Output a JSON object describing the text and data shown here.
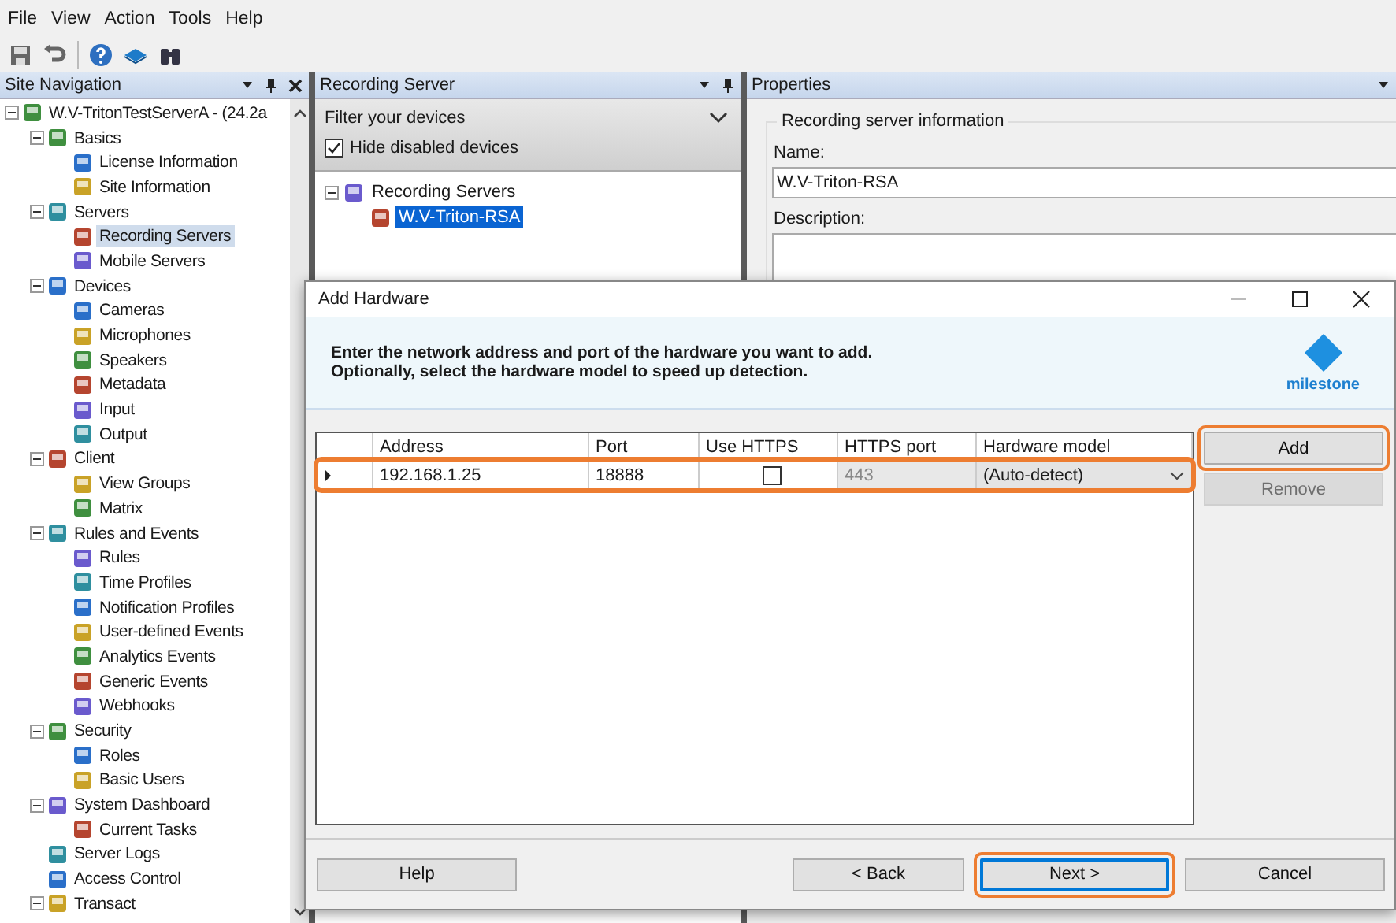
{
  "menu": [
    "File",
    "View",
    "Action",
    "Tools",
    "Help"
  ],
  "site_navigation": {
    "title": "Site Navigation",
    "tree": [
      {
        "label": "W.V-TritonTestServerA - (24.2a",
        "expanded": true,
        "selected": false,
        "children": [
          {
            "label": "Basics",
            "expanded": true,
            "selected": false,
            "children": [
              {
                "label": "License Information",
                "selected": false
              },
              {
                "label": "Site Information",
                "selected": false
              }
            ]
          },
          {
            "label": "Servers",
            "expanded": true,
            "selected": false,
            "children": [
              {
                "label": "Recording Servers",
                "selected": true
              },
              {
                "label": "Mobile Servers",
                "selected": false
              }
            ]
          },
          {
            "label": "Devices",
            "expanded": true,
            "selected": false,
            "children": [
              {
                "label": "Cameras",
                "selected": false
              },
              {
                "label": "Microphones",
                "selected": false
              },
              {
                "label": "Speakers",
                "selected": false
              },
              {
                "label": "Metadata",
                "selected": false
              },
              {
                "label": "Input",
                "selected": false
              },
              {
                "label": "Output",
                "selected": false
              }
            ]
          },
          {
            "label": "Client",
            "expanded": true,
            "selected": false,
            "children": [
              {
                "label": "View Groups",
                "selected": false
              },
              {
                "label": "Matrix",
                "selected": false
              }
            ]
          },
          {
            "label": "Rules and Events",
            "expanded": true,
            "selected": false,
            "children": [
              {
                "label": "Rules",
                "selected": false
              },
              {
                "label": "Time Profiles",
                "selected": false
              },
              {
                "label": "Notification Profiles",
                "selected": false
              },
              {
                "label": "User-defined Events",
                "selected": false
              },
              {
                "label": "Analytics Events",
                "selected": false
              },
              {
                "label": "Generic Events",
                "selected": false
              },
              {
                "label": "Webhooks",
                "selected": false
              }
            ]
          },
          {
            "label": "Security",
            "expanded": true,
            "selected": false,
            "children": [
              {
                "label": "Roles",
                "selected": false
              },
              {
                "label": "Basic Users",
                "selected": false
              }
            ]
          },
          {
            "label": "System Dashboard",
            "expanded": true,
            "selected": false,
            "children": [
              {
                "label": "Current Tasks",
                "selected": false
              }
            ]
          },
          {
            "label": "Server Logs",
            "selected": false
          },
          {
            "label": "Access Control",
            "selected": false
          },
          {
            "label": "Transact",
            "expanded": true,
            "selected": false
          }
        ]
      }
    ]
  },
  "recording_server_panel": {
    "title": "Recording Server",
    "filter": {
      "label": "Filter your devices",
      "expanded": true
    },
    "hide_disabled": {
      "label": "Hide disabled devices",
      "checked": true
    },
    "tree": [
      {
        "label": "Recording Servers",
        "expanded": true,
        "selected": false,
        "children": [
          {
            "label": "W.V-Triton-RSA",
            "selected": true
          }
        ]
      }
    ]
  },
  "properties_panel": {
    "title": "Properties",
    "group": "Recording server information",
    "name_label": "Name:",
    "name_value": "W.V-Triton-RSA",
    "description_label": "Description:"
  },
  "dialog": {
    "title": "Add Hardware",
    "instructions": [
      "Enter the network address and port of the hardware you want to add.",
      "Optionally, select the hardware model to speed up detection."
    ],
    "logo": "milestone",
    "columns": [
      "Address",
      "Port",
      "Use HTTPS",
      "HTTPS port",
      "Hardware model"
    ],
    "rows": [
      {
        "address": "192.168.1.25",
        "port": "18888",
        "use_https": false,
        "https_port": "443",
        "hardware_model": "(Auto-detect)",
        "current": true,
        "highlighted": true
      }
    ],
    "side_buttons": [
      {
        "label": "Add",
        "disabled": false,
        "highlighted": true
      },
      {
        "label": "Remove",
        "disabled": true,
        "highlighted": false
      }
    ],
    "footer_buttons": [
      {
        "label": "Help",
        "default": false,
        "highlighted": false
      },
      {
        "label": "< Back",
        "default": false,
        "highlighted": false
      },
      {
        "label": "Next >",
        "default": true,
        "highlighted": true
      },
      {
        "label": "Cancel",
        "default": false,
        "highlighted": false
      }
    ]
  }
}
